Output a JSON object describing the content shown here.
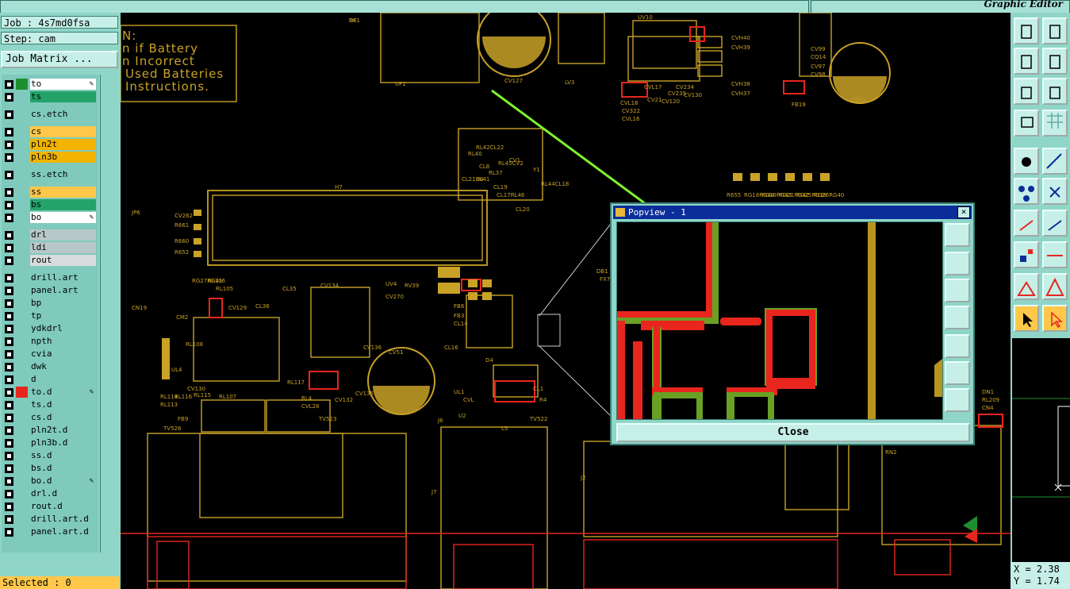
{
  "app": {
    "title": "Graphic Editor"
  },
  "job": {
    "label": "Job : 4s7md0fsa",
    "step": "Step: cam",
    "matrix_button": "Job Matrix ..."
  },
  "layers": [
    {
      "name": "to",
      "color": "#ffffff",
      "swatch": "#1d8f2f",
      "mark": "pencil"
    },
    {
      "name": "ts",
      "color": "#23a36a"
    },
    {
      "name": "cs.etch",
      "color": "#7fcabd"
    },
    {
      "name": "cs",
      "color": "#ffc84a"
    },
    {
      "name": "pln2t",
      "color": "#f2b400"
    },
    {
      "name": "pln3b",
      "color": "#f2b400"
    },
    {
      "name": "ss.etch",
      "color": "#7fcabd"
    },
    {
      "name": "ss",
      "color": "#ffc84a"
    },
    {
      "name": "bs",
      "color": "#23a36a"
    },
    {
      "name": "bo",
      "color": "#ffffff",
      "mark": "pencil"
    },
    {
      "name": "drl",
      "color": "#b8c8c8"
    },
    {
      "name": "ldi",
      "color": "#b8c8c8"
    },
    {
      "name": "rout",
      "color": "#d8dcdc"
    },
    {
      "name": "drill.art",
      "color": "#7fcabd"
    },
    {
      "name": "panel.art",
      "color": "#7fcabd"
    },
    {
      "name": "bp",
      "color": "#7fcabd"
    },
    {
      "name": "tp",
      "color": "#7fcabd"
    },
    {
      "name": "ydkdrl",
      "color": "#7fcabd"
    },
    {
      "name": "npth",
      "color": "#7fcabd"
    },
    {
      "name": "cvia",
      "color": "#7fcabd"
    },
    {
      "name": "dwk",
      "color": "#7fcabd"
    },
    {
      "name": "d",
      "color": "#7fcabd"
    },
    {
      "name": "to.d",
      "color": "#7fcabd",
      "swatch": "#e8261e",
      "mark": "pencil"
    },
    {
      "name": "ts.d",
      "color": "#7fcabd"
    },
    {
      "name": "cs.d",
      "color": "#7fcabd"
    },
    {
      "name": "pln2t.d",
      "color": "#7fcabd"
    },
    {
      "name": "pln3b.d",
      "color": "#7fcabd"
    },
    {
      "name": "ss.d",
      "color": "#7fcabd"
    },
    {
      "name": "bs.d",
      "color": "#7fcabd"
    },
    {
      "name": "bo.d",
      "color": "#7fcabd",
      "mark": "pencil"
    },
    {
      "name": "drl.d",
      "color": "#7fcabd"
    },
    {
      "name": "rout.d",
      "color": "#7fcabd"
    },
    {
      "name": "drill.art.d",
      "color": "#7fcabd"
    },
    {
      "name": "panel.art.d",
      "color": "#7fcabd"
    }
  ],
  "status": {
    "selected": "Selected : 0"
  },
  "coords": {
    "x": "X = 2.38",
    "y": "Y = 1.74"
  },
  "popview": {
    "title": "Popview - 1",
    "close_label": "Close"
  },
  "board": {
    "warning_lines": [
      "N:",
      "n if Battery",
      "n Incorrect",
      "Used Batteries",
      "Instructions."
    ],
    "refdes": [
      "DF1",
      "UF1",
      "CV127",
      "LV3",
      "UV10",
      "CVH40",
      "CVH39",
      "CVH38",
      "CVH37",
      "FB19",
      "CV99",
      "CQ14",
      "CV97",
      "CV98",
      "CQ11",
      "CVL18",
      "CV322",
      "CVL16",
      "CVL17",
      "CV234",
      "CV130",
      "CV235",
      "CV120",
      "CV21",
      "CL21RL41",
      "RL40",
      "RL42CL22",
      "CL8",
      "RL37",
      "RL45CV2",
      "CV1",
      "Y1",
      "U4",
      "CL19",
      "CL17RL46",
      "RL44CL18",
      "CL20",
      "H7",
      "JP6",
      "CV262",
      "R661",
      "R660",
      "R652",
      "R655",
      "RG18RG44",
      "RG19RG43",
      "RG21RG42",
      "RG25RG39",
      "RG26RG40",
      "RG27RG41",
      "RL106",
      "RL105",
      "CV129",
      "CL36",
      "CL35",
      "CV134",
      "UV4",
      "RV39",
      "CN19",
      "CM2",
      "RL108",
      "UL4",
      "CV130",
      "RL107",
      "RL116",
      "RL115",
      "RL114",
      "RL113",
      "RL117",
      "RL4",
      "CVL28",
      "CV132",
      "CV135",
      "CV270",
      "CV51",
      "CV136",
      "FB6",
      "FB3",
      "CL14",
      "CL16",
      "UL1",
      "CVL",
      "U2",
      "D4",
      "FB9",
      "TV523",
      "TV522",
      "TV526",
      "J7",
      "J2",
      "DB1",
      "FX7",
      "DN1",
      "RL209",
      "CN4",
      "RN2",
      "J6",
      "L5",
      "CL1",
      "R4",
      "R6"
    ]
  }
}
